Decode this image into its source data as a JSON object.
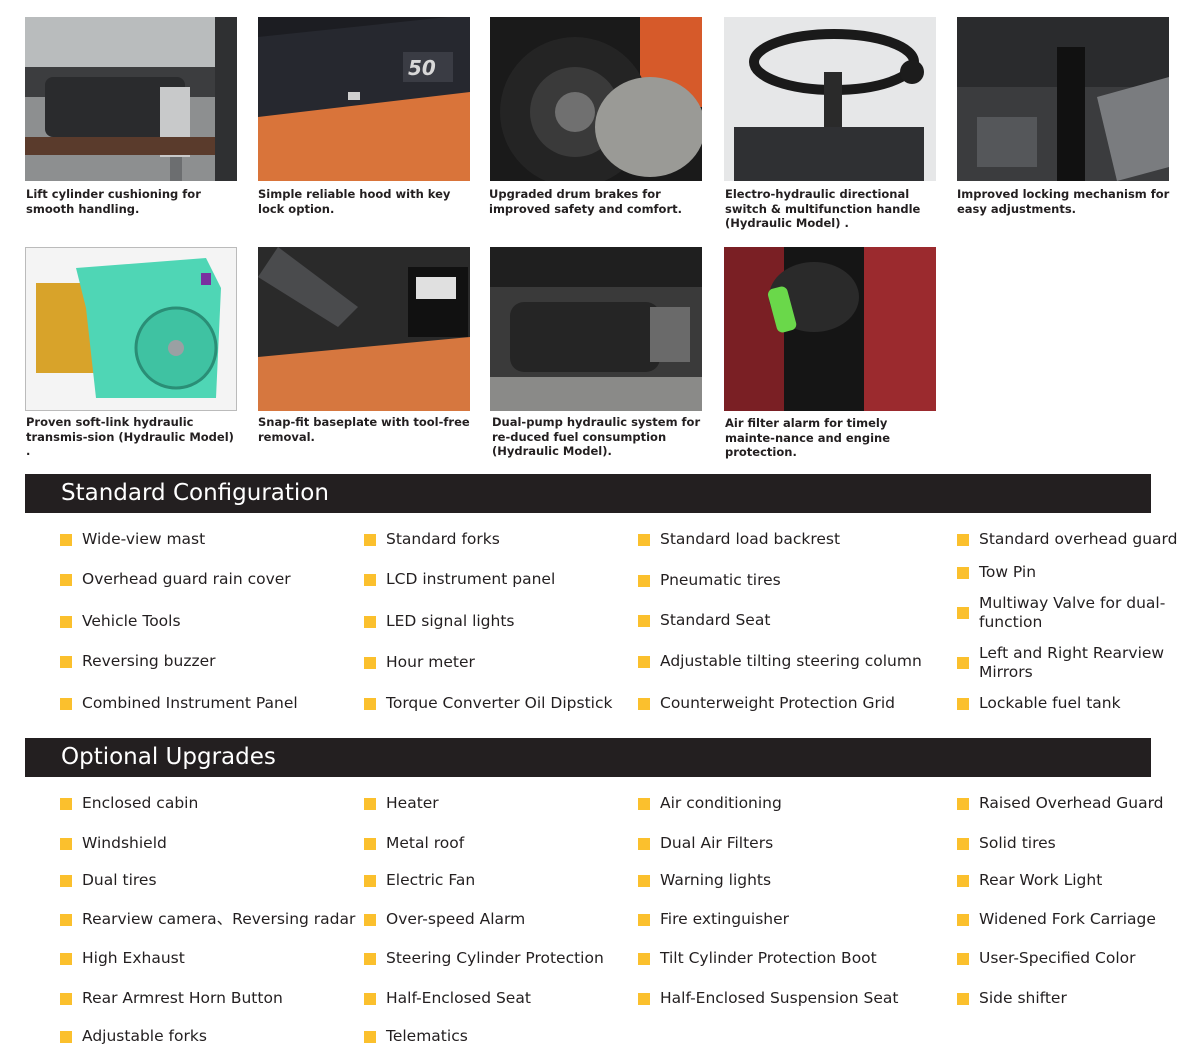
{
  "features": [
    {
      "caption": "Lift cylinder cushioning for smooth handling.",
      "icon": "lift-cylinder-photo"
    },
    {
      "caption": "Simple reliable hood with key lock option.",
      "icon": "hood-photo"
    },
    {
      "caption": "Upgraded drum brakes for improved safety and comfort.",
      "icon": "drum-brake-photo"
    },
    {
      "caption": "Electro-hydraulic  directional switch & multifunction handle (Hydraulic Model) .",
      "icon": "steering-handle-photo"
    },
    {
      "caption": "Improved locking mechanism for easy adjustments.",
      "icon": "locking-mechanism-photo"
    },
    {
      "caption": "Proven soft-link hydraulic transmis-sion (Hydraulic Model) .",
      "icon": "transmission-render"
    },
    {
      "caption": "Snap-fit baseplate with tool-free removal.",
      "icon": "baseplate-photo"
    },
    {
      "caption": "Dual-pump hydraulic system for re-duced fuel consumption (Hydraulic Model).",
      "icon": "hydraulic-pump-photo"
    },
    {
      "caption": "Air filter alarm for timely mainte-nance and engine protection.",
      "icon": "air-filter-alarm-photo"
    }
  ],
  "standard": {
    "title": "Standard Configuration",
    "columns": [
      [
        "Wide-view mast",
        "Overhead guard rain cover",
        "Vehicle Tools",
        "Reversing buzzer",
        "Combined Instrument Panel"
      ],
      [
        "Standard forks",
        "LCD instrument panel",
        "LED signal lights",
        "Hour meter",
        "Torque Converter Oil Dipstick"
      ],
      [
        "Standard load backrest",
        "Pneumatic tires",
        "Standard Seat",
        "Adjustable tilting steering column",
        "Counterweight Protection Grid"
      ],
      [
        "Standard overhead guard",
        "Tow Pin",
        "Multiway Valve for dual-function",
        "Left and Right Rearview Mirrors",
        "Lockable fuel tank"
      ]
    ]
  },
  "optional": {
    "title": "Optional Upgrades",
    "columns": [
      [
        "Enclosed cabin",
        "Windshield",
        "Dual tires",
        "Rearview camera、Reversing radar",
        "High Exhaust",
        "Rear Armrest Horn Button",
        "Adjustable forks"
      ],
      [
        "Heater",
        "Metal roof",
        "Electric Fan",
        "Over-speed Alarm",
        "Steering Cylinder Protection",
        "Half-Enclosed Seat",
        "Telematics"
      ],
      [
        "Air conditioning",
        "Dual Air Filters",
        "Warning lights",
        "Fire extinguisher",
        "Tilt Cylinder Protection Boot",
        "Half-Enclosed Suspension Seat"
      ],
      [
        "Raised Overhead Guard",
        "Solid tires",
        "Rear Work Light",
        "Widened Fork Carriage",
        "User-Specified Color",
        "Side shifter"
      ]
    ]
  },
  "colors": {
    "bar": "#231f20",
    "bullet": "#fbc02d",
    "text": "#231f20"
  }
}
